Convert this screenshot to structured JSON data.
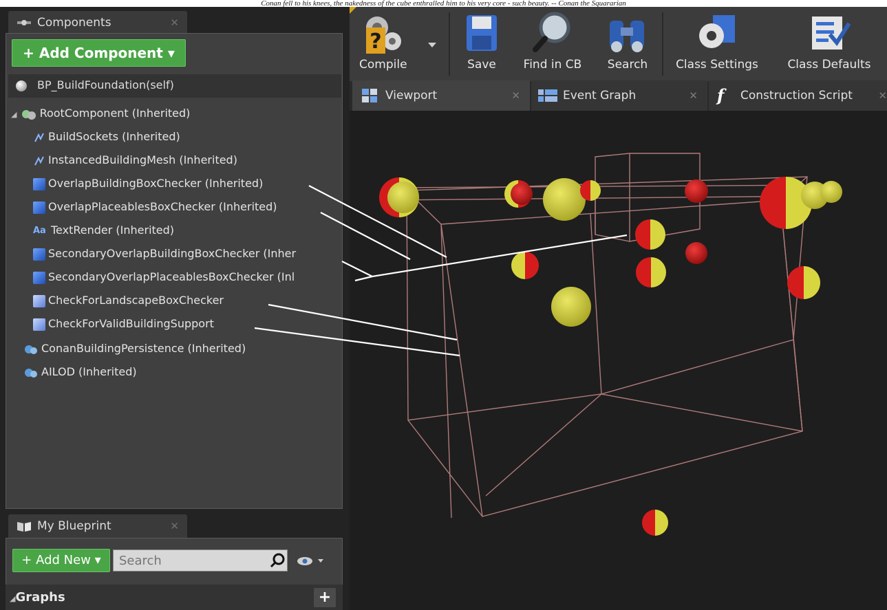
{
  "caption": "Conan fell to his knees, the nakedness of the cube enthralled him to his very core - such beauty. -- Conan the Squararian",
  "components_panel": {
    "tab_label": "Components",
    "add_button": "+ Add Component ▾",
    "self_row": "BP_BuildFoundation(self)",
    "tree": [
      {
        "label": "RootComponent (Inherited)",
        "icon": "scene-icon"
      },
      {
        "label": "BuildSockets (Inherited)",
        "icon": "socket-icon"
      },
      {
        "label": "InstancedBuildingMesh (Inherited)",
        "icon": "socket-icon"
      },
      {
        "label": "OverlapBuildingBoxChecker (Inherited)",
        "icon": "box-icon"
      },
      {
        "label": "OverlapPlaceablesBoxChecker (Inherited)",
        "icon": "box-icon"
      },
      {
        "label": "TextRender (Inherited)",
        "icon": "text-render-icon"
      },
      {
        "label": "SecondaryOverlapBuildingBoxChecker (Inher",
        "icon": "box-icon"
      },
      {
        "label": "SecondaryOverlapPlaceablesBoxChecker (Inl",
        "icon": "box-icon"
      },
      {
        "label": "CheckForLandscapeBoxChecker",
        "icon": "box-icon"
      },
      {
        "label": "CheckForValidBuildingSupport",
        "icon": "box-icon"
      },
      {
        "label": "ConanBuildingPersistence (Inherited)",
        "icon": "actor-component-icon"
      },
      {
        "label": "AILOD (Inherited)",
        "icon": "actor-component-icon"
      }
    ]
  },
  "my_blueprint": {
    "tab_label": "My Blueprint",
    "add_button": "+ Add New ▾",
    "search_placeholder": "Search",
    "graphs_label": "Graphs"
  },
  "toolbar": {
    "compile": "Compile",
    "save": "Save",
    "find_in_cb": "Find in CB",
    "search": "Search",
    "class_settings": "Class Settings",
    "class_defaults": "Class Defaults"
  },
  "editor_tabs": {
    "viewport": "Viewport",
    "event_graph": "Event Graph",
    "construction_script": "Construction Script"
  },
  "colors": {
    "green": "#4aa547",
    "sphere_yellow": "#d8d640",
    "sphere_red": "#d51c1c",
    "wire": "#b07a7a"
  }
}
